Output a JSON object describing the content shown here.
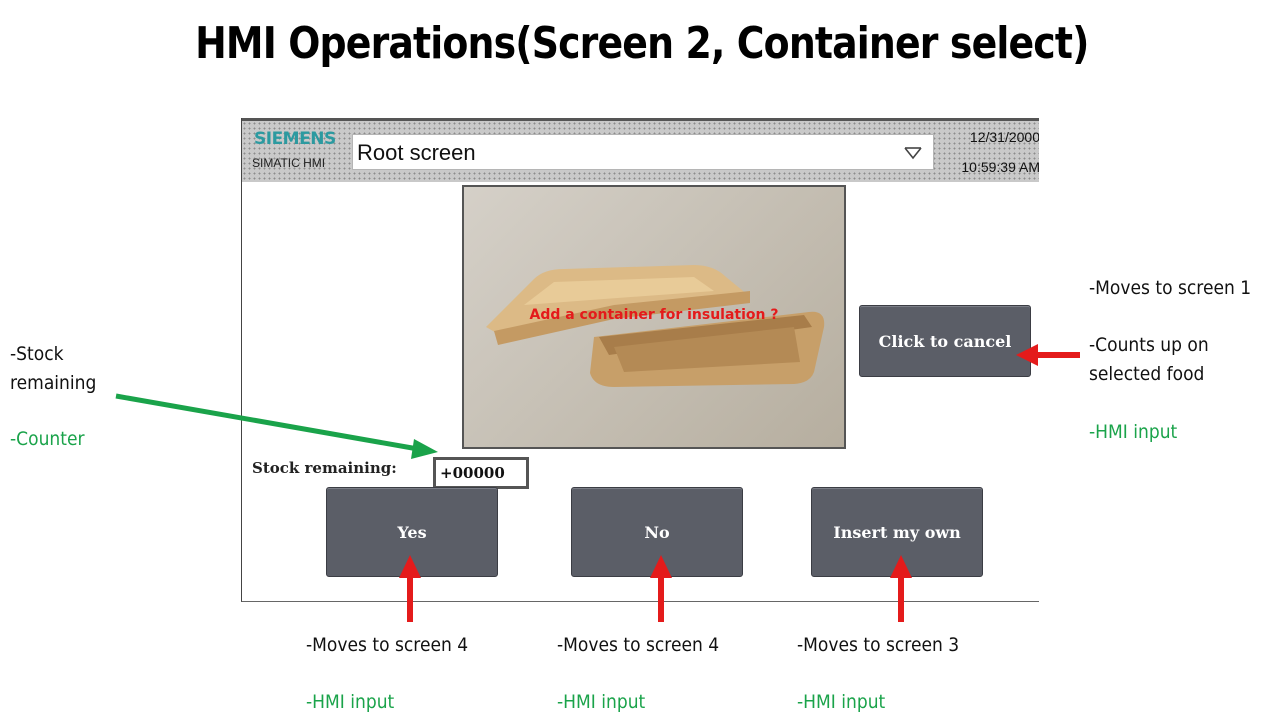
{
  "slide": {
    "title": "HMI Operations(Screen 2, Container select)"
  },
  "hmi": {
    "brand": "SIEMENS",
    "brand_sub": "SIMATIC HMI",
    "screen_select_value": "Root screen",
    "date": "12/31/2000",
    "time": "10:59:39 AM",
    "image_caption": "Add a container for insulation ?",
    "cancel_label": "Click to cancel",
    "stock_label": "Stock remaining:",
    "stock_value": "+00000",
    "yes_label": "Yes",
    "no_label": "No",
    "insert_label": "Insert my own"
  },
  "annotations": {
    "left": {
      "line1": "-Stock",
      "line2": "remaining",
      "tag": "-Counter"
    },
    "right": {
      "line1": "-Moves to screen 1",
      "line2": "-Counts up on",
      "line3": "selected food",
      "tag": "-HMI input"
    },
    "yes": {
      "text": "-Moves to screen 4",
      "tag": "-HMI input"
    },
    "no": {
      "text": "-Moves to screen 4",
      "tag": "-HMI input"
    },
    "insert": {
      "text": "-Moves to screen 3",
      "tag": "-HMI input"
    }
  },
  "colors": {
    "annotation_green": "#1aa34a",
    "arrow_red": "#e41b1b",
    "arrow_green": "#1aa34a",
    "button_gray": "#5b5e67",
    "brand_teal": "#2c9aa0"
  },
  "icons": {
    "dropdown": "chevron-down-icon"
  }
}
